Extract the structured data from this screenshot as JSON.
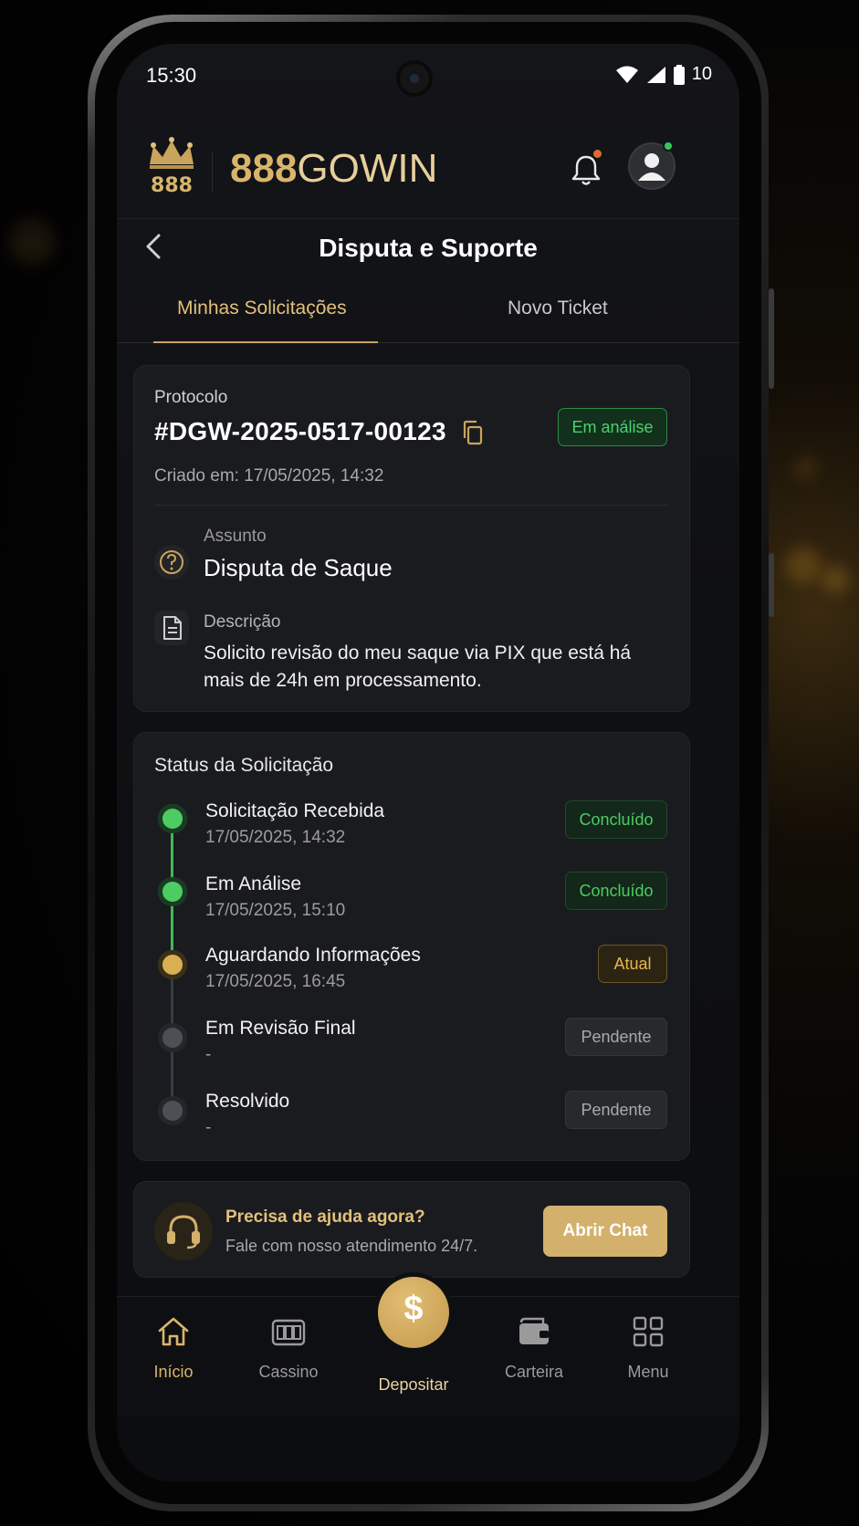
{
  "status_bar": {
    "time": "15:30",
    "battery": "10"
  },
  "header": {
    "brand_number": "888",
    "brand_word": "GOWIN",
    "logo_icon": "crown-888-logo"
  },
  "page": {
    "title": "Disputa e Suporte"
  },
  "tabs": [
    {
      "label": "Minhas Solicitações",
      "active": true
    },
    {
      "label": "Novo Ticket",
      "active": false
    }
  ],
  "ticket": {
    "protocol_label": "Protocolo",
    "protocol_number": "#DGW-2025-0517-00123",
    "status_badge": "Em análise",
    "created": "Criado em: 17/05/2025, 14:32",
    "subject_label": "Assunto",
    "subject_value": "Disputa de Saque",
    "description_label": "Descrição",
    "description_value": "Solicito revisão do meu saque via PIX que está há mais de 24h em processamento."
  },
  "status_section": {
    "title": "Status da Solicitação",
    "steps": [
      {
        "name": "Solicitação Recebida",
        "date": "17/05/2025, 14:32",
        "badge": "Concluído",
        "state": "done"
      },
      {
        "name": "Em Análise",
        "date": "17/05/2025, 15:10",
        "badge": "Concluído",
        "state": "done"
      },
      {
        "name": "Aguardando Informações",
        "date": "17/05/2025, 16:45",
        "badge": "Atual",
        "state": "current"
      },
      {
        "name": "Em Revisão Final",
        "date": "-",
        "badge": "Pendente",
        "state": "pending"
      },
      {
        "name": "Resolvido",
        "date": "-",
        "badge": "Pendente",
        "state": "pending"
      }
    ]
  },
  "help": {
    "title": "Precisa de ajuda agora?",
    "subtitle": "Fale com nosso atendimento 24/7.",
    "button": "Abrir Chat"
  },
  "bottom_nav": {
    "items": [
      {
        "label": "Início",
        "icon": "home-icon",
        "active": true
      },
      {
        "label": "Cassino",
        "icon": "slot-machine-icon",
        "active": false
      },
      {
        "label": "Depositar",
        "icon": "dollar-icon",
        "active": false
      },
      {
        "label": "Carteira",
        "icon": "wallet-icon",
        "active": false
      },
      {
        "label": "Menu",
        "icon": "grid-icon",
        "active": false
      }
    ],
    "deposit_symbol": "$"
  },
  "colors": {
    "gold": "#d9b56b",
    "green": "#4ccc63",
    "amber": "#e5b64e",
    "background": "#0f1013"
  }
}
